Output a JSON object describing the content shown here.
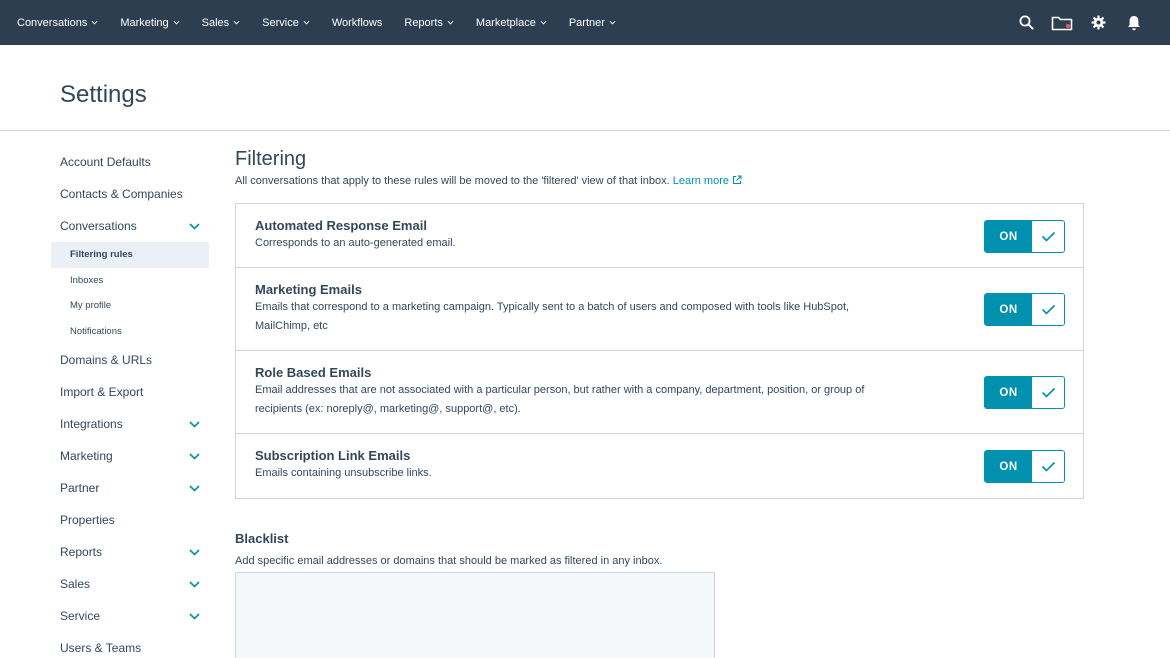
{
  "topnav": {
    "items": [
      {
        "label": "Conversations",
        "caret": true
      },
      {
        "label": "Marketing",
        "caret": true
      },
      {
        "label": "Sales",
        "caret": true
      },
      {
        "label": "Service",
        "caret": true
      },
      {
        "label": "Workflows",
        "caret": false
      },
      {
        "label": "Reports",
        "caret": true
      },
      {
        "label": "Marketplace",
        "caret": true
      },
      {
        "label": "Partner",
        "caret": true
      }
    ],
    "icons": [
      "search-icon",
      "inbox-folder-icon",
      "gear-icon",
      "bell-icon"
    ],
    "accent_notification": "#f2545b"
  },
  "header": {
    "title": "Settings"
  },
  "sidebar": {
    "items": [
      {
        "label": "Account Defaults",
        "chevron": false
      },
      {
        "label": "Contacts & Companies",
        "chevron": false
      },
      {
        "label": "Conversations",
        "chevron": true,
        "children": [
          {
            "label": "Filtering rules",
            "active": true
          },
          {
            "label": "Inboxes",
            "active": false
          },
          {
            "label": "My profile",
            "active": false
          },
          {
            "label": "Notifications",
            "active": false
          }
        ]
      },
      {
        "label": "Domains & URLs",
        "chevron": false
      },
      {
        "label": "Import & Export",
        "chevron": false
      },
      {
        "label": "Integrations",
        "chevron": true
      },
      {
        "label": "Marketing",
        "chevron": true
      },
      {
        "label": "Partner",
        "chevron": true
      },
      {
        "label": "Properties",
        "chevron": false
      },
      {
        "label": "Reports",
        "chevron": true
      },
      {
        "label": "Sales",
        "chevron": true
      },
      {
        "label": "Service",
        "chevron": true
      },
      {
        "label": "Users & Teams",
        "chevron": false
      }
    ]
  },
  "filtering": {
    "title": "Filtering",
    "description": "All conversations that apply to these rules will be moved to the 'filtered' view of that inbox.",
    "learn_more": "Learn more",
    "rules": [
      {
        "title": "Automated Response Email",
        "description": "Corresponds to an auto-generated email.",
        "toggle": "ON"
      },
      {
        "title": "Marketing Emails",
        "description": "Emails that correspond to a marketing campaign. Typically sent to a batch of users and composed with tools like HubSpot, MailChimp, etc",
        "toggle": "ON"
      },
      {
        "title": "Role Based Emails",
        "description": "Email addresses that are not associated with a particular person, but rather with a company, department, position, or group of recipients (ex: noreply@, marketing@, support@, etc).",
        "toggle": "ON"
      },
      {
        "title": "Subscription Link Emails",
        "description": "Emails containing unsubscribe links.",
        "toggle": "ON"
      }
    ]
  },
  "blacklist": {
    "title": "Blacklist",
    "description": "Add specific email addresses or domains that should be marked as filtered in any inbox.",
    "value": ""
  },
  "colors": {
    "nav_bg": "#2d3e50",
    "text": "#33475b",
    "accent": "#0091ae",
    "border": "#cbd6e2",
    "active_bg": "#eaf0f6"
  }
}
